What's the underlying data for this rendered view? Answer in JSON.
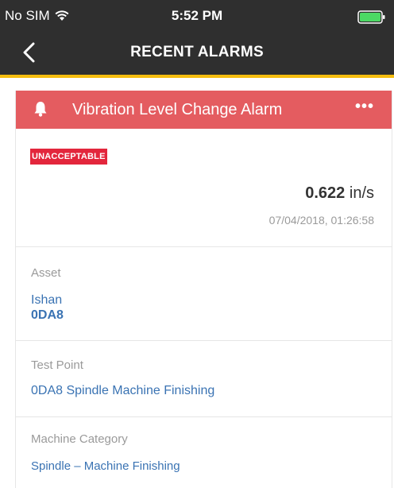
{
  "status": {
    "carrier": "No SIM",
    "time": "5:52 PM"
  },
  "nav": {
    "title": "RECENT ALARMS"
  },
  "alarm": {
    "name": "Vibration Level Change Alarm",
    "more": "•••",
    "severity": "UNACCEPTABLE",
    "value": "0.622",
    "unit": "in/s",
    "timestamp": "07/04/2018, 01:26:58",
    "header_color": "#e45c60",
    "badge_color": "#e3263c"
  },
  "asset": {
    "label": "Asset",
    "name": "Ishan",
    "code": "0DA8"
  },
  "test_point": {
    "label": "Test Point",
    "value": "0DA8 Spindle Machine Finishing"
  },
  "machine_category": {
    "label": "Machine Category",
    "value": "Spindle – Machine Finishing"
  },
  "colors": {
    "accent": "#f5bd0e",
    "link": "#3a73b3",
    "header_bg": "#2f2f2f"
  }
}
